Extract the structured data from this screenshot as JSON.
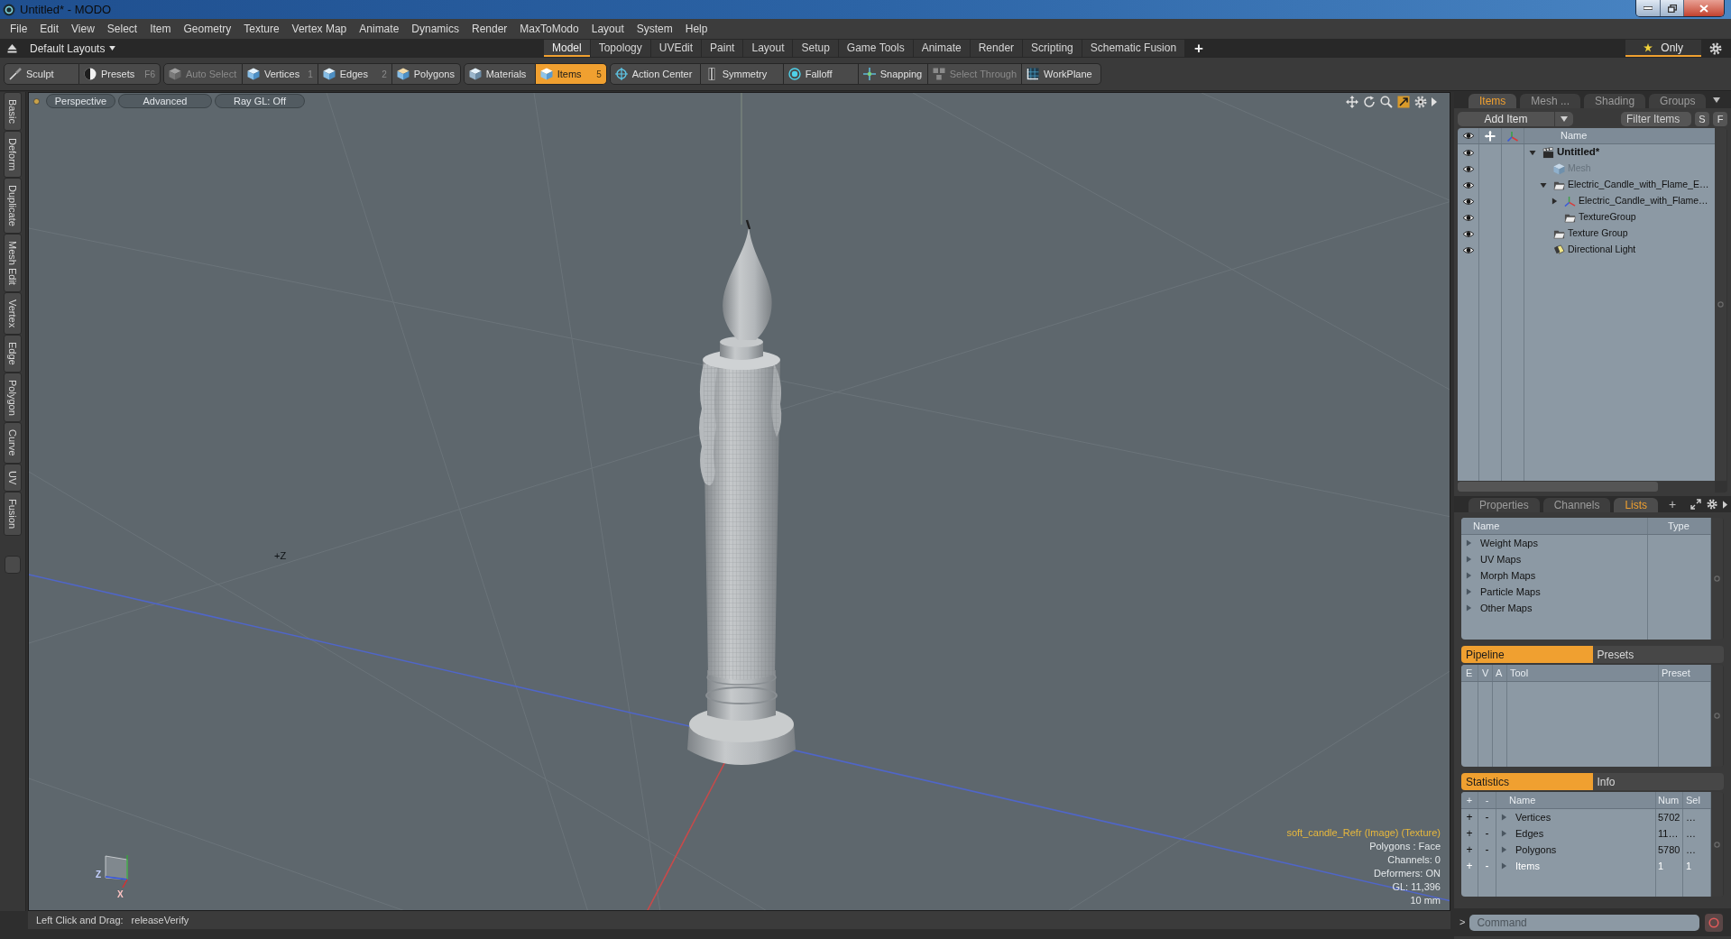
{
  "window": {
    "title": "Untitled* - MODO"
  },
  "menu_bar": [
    "File",
    "Edit",
    "View",
    "Select",
    "Item",
    "Geometry",
    "Texture",
    "Vertex Map",
    "Animate",
    "Dynamics",
    "Render",
    "MaxToModo",
    "Layout",
    "System",
    "Help"
  ],
  "layout_bar": {
    "layouts_menu": "Default Layouts",
    "tabs": [
      {
        "label": "Model",
        "selected": true
      },
      {
        "label": "Topology",
        "selected": false
      },
      {
        "label": "UVEdit",
        "selected": false
      },
      {
        "label": "Paint",
        "selected": false
      },
      {
        "label": "Layout",
        "selected": false
      },
      {
        "label": "Setup",
        "selected": false
      },
      {
        "label": "Game Tools",
        "selected": false
      },
      {
        "label": "Animate",
        "selected": false
      },
      {
        "label": "Render",
        "selected": false
      },
      {
        "label": "Scripting",
        "selected": false
      },
      {
        "label": "Schematic Fusion",
        "selected": false
      }
    ],
    "add_tab": "+",
    "favorites_button": "Only"
  },
  "toolbar": [
    {
      "buttons": [
        {
          "label": "Sculpt",
          "selected": false,
          "disabled": false
        },
        {
          "label": "Presets",
          "shortcut": "F6",
          "selected": false,
          "disabled": false
        }
      ]
    },
    {
      "buttons": [
        {
          "label": "Auto Select",
          "selected": false,
          "disabled": true
        },
        {
          "label": "Vertices",
          "shortcut": "1",
          "selected": false,
          "disabled": false
        },
        {
          "label": "Edges",
          "shortcut": "2",
          "selected": false,
          "disabled": false
        },
        {
          "label": "Polygons",
          "selected": false,
          "disabled": false
        }
      ]
    },
    {
      "buttons": [
        {
          "label": "Materials",
          "selected": false,
          "disabled": false
        },
        {
          "label": "Items",
          "shortcut": "5",
          "selected": true,
          "disabled": false
        }
      ]
    },
    {
      "buttons": [
        {
          "label": "Action Center",
          "selected": false,
          "disabled": false
        },
        {
          "label": "Symmetry",
          "selected": false,
          "disabled": false
        },
        {
          "label": "Falloff",
          "selected": false,
          "disabled": false
        },
        {
          "label": "Snapping",
          "selected": false,
          "disabled": false
        },
        {
          "label": "Select Through",
          "selected": false,
          "disabled": true
        },
        {
          "label": "WorkPlane",
          "selected": false,
          "disabled": false
        }
      ]
    }
  ],
  "left_tabs": [
    "Basic",
    "Deform",
    "Duplicate",
    "Mesh Edit",
    "Vertex",
    "Edge",
    "Polygon",
    "Curve",
    "UV",
    "Fusion"
  ],
  "viewport": {
    "view_buttons": [
      "Perspective",
      "Advanced",
      "Ray GL: Off"
    ],
    "grid_label": "+Z",
    "gizmo_labels": [
      "Z",
      "X"
    ],
    "info_title": "soft_candle_Refr (Image) (Texture)",
    "info_lines": [
      "Polygons : Face",
      "Channels: 0",
      "Deformers: ON",
      "GL: 11,396",
      "10 mm"
    ]
  },
  "status_bar": {
    "label": "Left Click and Drag:",
    "value": "releaseVerify"
  },
  "items_panel": {
    "tabs": [
      {
        "label": "Items",
        "selected": true
      },
      {
        "label": "Mesh ...",
        "selected": false
      },
      {
        "label": "Shading",
        "selected": false
      },
      {
        "label": "Groups",
        "selected": false
      }
    ],
    "add_button": "Add Item",
    "filter": {
      "placeholder": "Filter Items"
    },
    "filter_buttons": [
      "S",
      "F"
    ],
    "columns": [
      "Name"
    ],
    "tree": [
      {
        "name": "Untitled*",
        "kind": "scene",
        "expanded": true,
        "dimmed": false,
        "children": [
          {
            "name": "Mesh",
            "kind": "mesh",
            "dimmed": true
          },
          {
            "name": "Electric_Candle_with_Flame_E…",
            "kind": "group",
            "expanded": true,
            "dimmed": false,
            "children": [
              {
                "name": "Electric_Candle_with_Flame…",
                "kind": "locator",
                "expanded": false,
                "dimmed": false
              },
              {
                "name": "TextureGroup",
                "kind": "group",
                "dimmed": false
              }
            ]
          },
          {
            "name": "Texture Group",
            "kind": "group",
            "dimmed": false
          },
          {
            "name": "Directional Light",
            "kind": "light",
            "dimmed": false
          }
        ]
      }
    ]
  },
  "lists_panel": {
    "tabs": [
      {
        "label": "Properties",
        "selected": false
      },
      {
        "label": "Channels",
        "selected": false
      },
      {
        "label": "Lists",
        "selected": true
      }
    ],
    "add_tab": "+",
    "columns": [
      "Name",
      "Type"
    ],
    "rows": [
      "Weight Maps",
      "UV Maps",
      "Morph Maps",
      "Particle Maps",
      "Other Maps"
    ]
  },
  "pipeline_panel": {
    "tabs": [
      {
        "label": "Pipeline",
        "selected": true
      },
      {
        "label": "Presets",
        "selected": false
      }
    ],
    "columns": [
      "E",
      "V",
      "A",
      "Tool",
      "Preset"
    ]
  },
  "statistics_panel": {
    "tabs": [
      {
        "label": "Statistics",
        "selected": true
      },
      {
        "label": "Info",
        "selected": false
      }
    ],
    "columns": [
      "+",
      "-",
      "Name",
      "Num",
      "Sel"
    ],
    "rows": [
      {
        "add": "+",
        "remove": "-",
        "name": "Vertices",
        "num": "5702",
        "sel": "…",
        "highlighted": false
      },
      {
        "add": "+",
        "remove": "-",
        "name": "Edges",
        "num": "11…",
        "sel": "…",
        "highlighted": false
      },
      {
        "add": "+",
        "remove": "-",
        "name": "Polygons",
        "num": "5780",
        "sel": "…",
        "highlighted": false
      },
      {
        "add": "+",
        "remove": "-",
        "name": "Items",
        "num": "1",
        "sel": "1",
        "highlighted": true
      }
    ]
  },
  "command_bar": {
    "prompt": ">",
    "placeholder": "Command"
  }
}
